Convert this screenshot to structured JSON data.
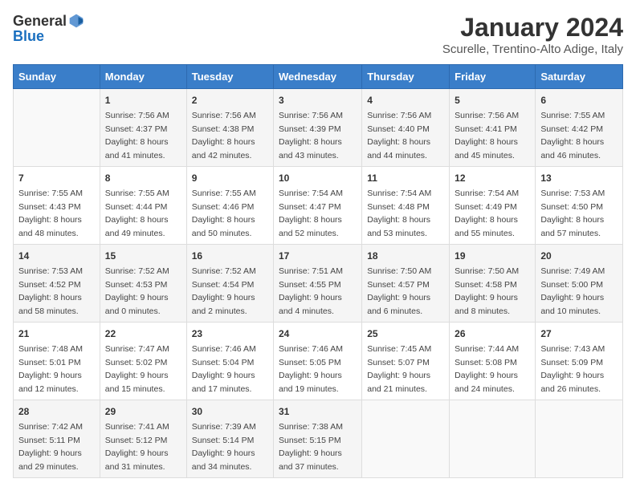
{
  "logo": {
    "general": "General",
    "blue": "Blue"
  },
  "title": "January 2024",
  "location": "Scurelle, Trentino-Alto Adige, Italy",
  "days_of_week": [
    "Sunday",
    "Monday",
    "Tuesday",
    "Wednesday",
    "Thursday",
    "Friday",
    "Saturday"
  ],
  "weeks": [
    [
      {
        "day": "",
        "sunrise": "",
        "sunset": "",
        "daylight": ""
      },
      {
        "day": "1",
        "sunrise": "Sunrise: 7:56 AM",
        "sunset": "Sunset: 4:37 PM",
        "daylight": "Daylight: 8 hours and 41 minutes."
      },
      {
        "day": "2",
        "sunrise": "Sunrise: 7:56 AM",
        "sunset": "Sunset: 4:38 PM",
        "daylight": "Daylight: 8 hours and 42 minutes."
      },
      {
        "day": "3",
        "sunrise": "Sunrise: 7:56 AM",
        "sunset": "Sunset: 4:39 PM",
        "daylight": "Daylight: 8 hours and 43 minutes."
      },
      {
        "day": "4",
        "sunrise": "Sunrise: 7:56 AM",
        "sunset": "Sunset: 4:40 PM",
        "daylight": "Daylight: 8 hours and 44 minutes."
      },
      {
        "day": "5",
        "sunrise": "Sunrise: 7:56 AM",
        "sunset": "Sunset: 4:41 PM",
        "daylight": "Daylight: 8 hours and 45 minutes."
      },
      {
        "day": "6",
        "sunrise": "Sunrise: 7:55 AM",
        "sunset": "Sunset: 4:42 PM",
        "daylight": "Daylight: 8 hours and 46 minutes."
      }
    ],
    [
      {
        "day": "7",
        "sunrise": "Sunrise: 7:55 AM",
        "sunset": "Sunset: 4:43 PM",
        "daylight": "Daylight: 8 hours and 48 minutes."
      },
      {
        "day": "8",
        "sunrise": "Sunrise: 7:55 AM",
        "sunset": "Sunset: 4:44 PM",
        "daylight": "Daylight: 8 hours and 49 minutes."
      },
      {
        "day": "9",
        "sunrise": "Sunrise: 7:55 AM",
        "sunset": "Sunset: 4:46 PM",
        "daylight": "Daylight: 8 hours and 50 minutes."
      },
      {
        "day": "10",
        "sunrise": "Sunrise: 7:54 AM",
        "sunset": "Sunset: 4:47 PM",
        "daylight": "Daylight: 8 hours and 52 minutes."
      },
      {
        "day": "11",
        "sunrise": "Sunrise: 7:54 AM",
        "sunset": "Sunset: 4:48 PM",
        "daylight": "Daylight: 8 hours and 53 minutes."
      },
      {
        "day": "12",
        "sunrise": "Sunrise: 7:54 AM",
        "sunset": "Sunset: 4:49 PM",
        "daylight": "Daylight: 8 hours and 55 minutes."
      },
      {
        "day": "13",
        "sunrise": "Sunrise: 7:53 AM",
        "sunset": "Sunset: 4:50 PM",
        "daylight": "Daylight: 8 hours and 57 minutes."
      }
    ],
    [
      {
        "day": "14",
        "sunrise": "Sunrise: 7:53 AM",
        "sunset": "Sunset: 4:52 PM",
        "daylight": "Daylight: 8 hours and 58 minutes."
      },
      {
        "day": "15",
        "sunrise": "Sunrise: 7:52 AM",
        "sunset": "Sunset: 4:53 PM",
        "daylight": "Daylight: 9 hours and 0 minutes."
      },
      {
        "day": "16",
        "sunrise": "Sunrise: 7:52 AM",
        "sunset": "Sunset: 4:54 PM",
        "daylight": "Daylight: 9 hours and 2 minutes."
      },
      {
        "day": "17",
        "sunrise": "Sunrise: 7:51 AM",
        "sunset": "Sunset: 4:55 PM",
        "daylight": "Daylight: 9 hours and 4 minutes."
      },
      {
        "day": "18",
        "sunrise": "Sunrise: 7:50 AM",
        "sunset": "Sunset: 4:57 PM",
        "daylight": "Daylight: 9 hours and 6 minutes."
      },
      {
        "day": "19",
        "sunrise": "Sunrise: 7:50 AM",
        "sunset": "Sunset: 4:58 PM",
        "daylight": "Daylight: 9 hours and 8 minutes."
      },
      {
        "day": "20",
        "sunrise": "Sunrise: 7:49 AM",
        "sunset": "Sunset: 5:00 PM",
        "daylight": "Daylight: 9 hours and 10 minutes."
      }
    ],
    [
      {
        "day": "21",
        "sunrise": "Sunrise: 7:48 AM",
        "sunset": "Sunset: 5:01 PM",
        "daylight": "Daylight: 9 hours and 12 minutes."
      },
      {
        "day": "22",
        "sunrise": "Sunrise: 7:47 AM",
        "sunset": "Sunset: 5:02 PM",
        "daylight": "Daylight: 9 hours and 15 minutes."
      },
      {
        "day": "23",
        "sunrise": "Sunrise: 7:46 AM",
        "sunset": "Sunset: 5:04 PM",
        "daylight": "Daylight: 9 hours and 17 minutes."
      },
      {
        "day": "24",
        "sunrise": "Sunrise: 7:46 AM",
        "sunset": "Sunset: 5:05 PM",
        "daylight": "Daylight: 9 hours and 19 minutes."
      },
      {
        "day": "25",
        "sunrise": "Sunrise: 7:45 AM",
        "sunset": "Sunset: 5:07 PM",
        "daylight": "Daylight: 9 hours and 21 minutes."
      },
      {
        "day": "26",
        "sunrise": "Sunrise: 7:44 AM",
        "sunset": "Sunset: 5:08 PM",
        "daylight": "Daylight: 9 hours and 24 minutes."
      },
      {
        "day": "27",
        "sunrise": "Sunrise: 7:43 AM",
        "sunset": "Sunset: 5:09 PM",
        "daylight": "Daylight: 9 hours and 26 minutes."
      }
    ],
    [
      {
        "day": "28",
        "sunrise": "Sunrise: 7:42 AM",
        "sunset": "Sunset: 5:11 PM",
        "daylight": "Daylight: 9 hours and 29 minutes."
      },
      {
        "day": "29",
        "sunrise": "Sunrise: 7:41 AM",
        "sunset": "Sunset: 5:12 PM",
        "daylight": "Daylight: 9 hours and 31 minutes."
      },
      {
        "day": "30",
        "sunrise": "Sunrise: 7:39 AM",
        "sunset": "Sunset: 5:14 PM",
        "daylight": "Daylight: 9 hours and 34 minutes."
      },
      {
        "day": "31",
        "sunrise": "Sunrise: 7:38 AM",
        "sunset": "Sunset: 5:15 PM",
        "daylight": "Daylight: 9 hours and 37 minutes."
      },
      {
        "day": "",
        "sunrise": "",
        "sunset": "",
        "daylight": ""
      },
      {
        "day": "",
        "sunrise": "",
        "sunset": "",
        "daylight": ""
      },
      {
        "day": "",
        "sunrise": "",
        "sunset": "",
        "daylight": ""
      }
    ]
  ]
}
